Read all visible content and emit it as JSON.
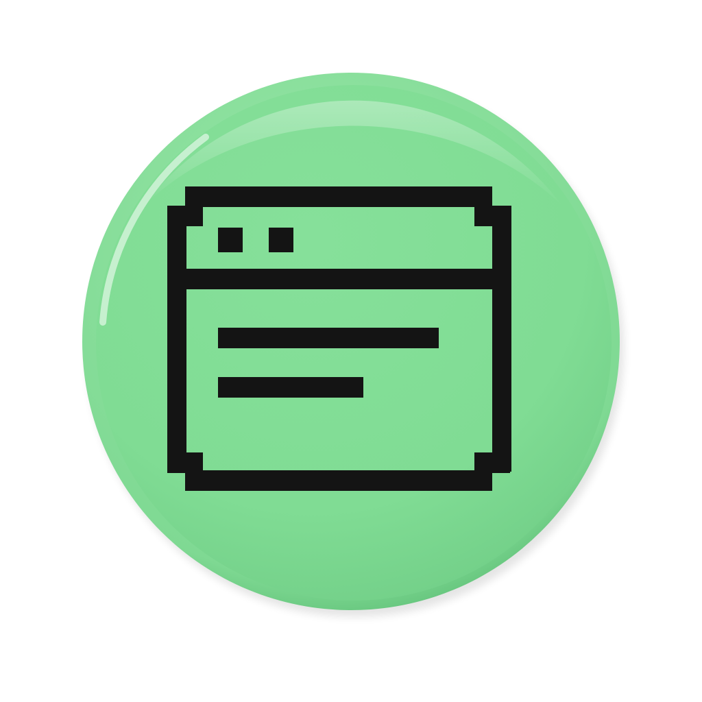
{
  "icon": {
    "name": "browser-window-icon",
    "style": "pixel-art",
    "details": [
      "title-bar-dot",
      "title-bar-dot",
      "content-line-long",
      "content-line-short"
    ]
  },
  "badge": {
    "shape": "3d-glossy-circle"
  },
  "colors": {
    "page_background": "#ffffff",
    "badge_face": "#80dc94",
    "badge_rim_light": "#b9f1c6",
    "badge_rim_shadow": "#5bbd74",
    "icon_stroke": "#141414"
  }
}
